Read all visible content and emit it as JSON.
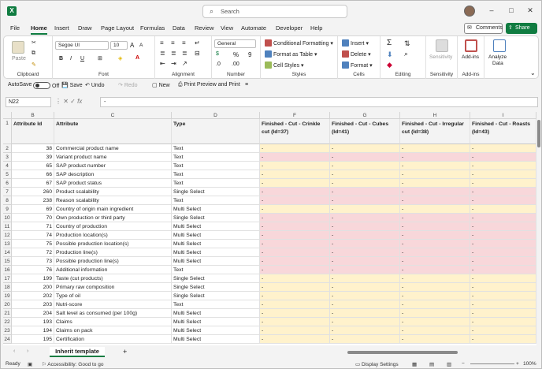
{
  "app": {
    "search_placeholder": "Search",
    "icons": {
      "logo": "excel-icon",
      "search": "search-icon"
    }
  },
  "window_controls": {
    "minimize": "–",
    "maximize": "□",
    "close": "✕"
  },
  "menu": {
    "items": [
      "File",
      "Home",
      "Insert",
      "Draw",
      "Page Layout",
      "Formulas",
      "Data",
      "Review",
      "View",
      "Automate",
      "Developer",
      "Help"
    ],
    "active": "Home"
  },
  "comments_label": "Comments",
  "share_label": "Share",
  "ribbon": {
    "clipboard": {
      "paste": "Paste",
      "label": "Clipboard"
    },
    "font": {
      "name": "Segoe UI",
      "size": "10",
      "bold": "B",
      "italic": "I",
      "underline": "U",
      "grow": "A",
      "shrink": "A",
      "label": "Font"
    },
    "alignment": {
      "label": "Alignment"
    },
    "number": {
      "format": "General",
      "percent": "%",
      "comma": "9",
      "label": "Number"
    },
    "styles": {
      "conditional": "Conditional Formatting",
      "table": "Format as Table",
      "cell_styles": "Cell Styles",
      "label": "Styles"
    },
    "cells": {
      "insert": "Insert",
      "delete": "Delete",
      "format": "Format",
      "label": "Cells"
    },
    "editing": {
      "sum": "Σ",
      "label": "Editing"
    },
    "sensitivity": {
      "button": "Sensitivity",
      "label": "Sensitivity"
    },
    "addins": {
      "button": "Add-ins",
      "label": "Add-ins"
    },
    "analyze": {
      "button1": "Analyze",
      "button2": "Data"
    }
  },
  "qat": {
    "autosave": "AutoSave",
    "autosave_state": "Off",
    "save": "Save",
    "undo": "Undo",
    "redo": "Redo",
    "new": "New",
    "print": "Print Preview and Print"
  },
  "formula_bar": {
    "name_box": "N22",
    "fx": "fx",
    "value": "-"
  },
  "columns": [
    "B",
    "C",
    "D",
    "F",
    "G",
    "H",
    "I"
  ],
  "headers": [
    "Attribute Id",
    "Attribute",
    "Type",
    "Finished - Cut - Crinkle cut (Id=37)",
    "Finished - Cut - Cubes (Id=41)",
    "Finished - Cut - Irregular cut (Id=38)",
    "Finished - Cut - Roasts (Id=43)"
  ],
  "rows": [
    {
      "n": "2",
      "id": "38",
      "attr": "Commercial product name",
      "type": "Text",
      "band": "y"
    },
    {
      "n": "3",
      "id": "39",
      "attr": "Variant product name",
      "type": "Text",
      "band": "p"
    },
    {
      "n": "4",
      "id": "65",
      "attr": "SAP product number",
      "type": "Text",
      "band": "y"
    },
    {
      "n": "5",
      "id": "66",
      "attr": "SAP description",
      "type": "Text",
      "band": "y"
    },
    {
      "n": "6",
      "id": "67",
      "attr": "SAP product status",
      "type": "Text",
      "band": "y"
    },
    {
      "n": "7",
      "id": "260",
      "attr": "Product scalability",
      "type": "Single Select",
      "band": "p"
    },
    {
      "n": "8",
      "id": "238",
      "attr": "Reason scalability",
      "type": "Text",
      "band": "p"
    },
    {
      "n": "9",
      "id": "69",
      "attr": "Country of origin main ingredient",
      "type": "Multi Select",
      "band": "y"
    },
    {
      "n": "10",
      "id": "70",
      "attr": "Own production or third party",
      "type": "Single Select",
      "band": "p"
    },
    {
      "n": "11",
      "id": "71",
      "attr": "Country of production",
      "type": "Multi Select",
      "band": "p"
    },
    {
      "n": "12",
      "id": "74",
      "attr": "Production location(s)",
      "type": "Multi Select",
      "band": "p"
    },
    {
      "n": "13",
      "id": "75",
      "attr": "Possible production location(s)",
      "type": "Multi Select",
      "band": "p"
    },
    {
      "n": "14",
      "id": "72",
      "attr": "Production line(s)",
      "type": "Multi Select",
      "band": "p"
    },
    {
      "n": "15",
      "id": "73",
      "attr": "Possible production line(s)",
      "type": "Multi Select",
      "band": "p"
    },
    {
      "n": "16",
      "id": "76",
      "attr": "Additional information",
      "type": "Text",
      "band": "p"
    },
    {
      "n": "17",
      "id": "199",
      "attr": "Taste (cut products)",
      "type": "Single Select",
      "band": "y"
    },
    {
      "n": "18",
      "id": "200",
      "attr": "Primary raw composition",
      "type": "Single Select",
      "band": "y"
    },
    {
      "n": "19",
      "id": "202",
      "attr": "Type of oil",
      "type": "Single Select",
      "band": "y"
    },
    {
      "n": "20",
      "id": "203",
      "attr": "Nutri-score",
      "type": "Text",
      "band": "y"
    },
    {
      "n": "21",
      "id": "204",
      "attr": "Salt level as consumed (per 100g)",
      "type": "Multi Select",
      "band": "y"
    },
    {
      "n": "22",
      "id": "193",
      "attr": "Claims",
      "type": "Multi Select",
      "band": "y"
    },
    {
      "n": "23",
      "id": "194",
      "attr": "Claims on pack",
      "type": "Multi Select",
      "band": "y"
    },
    {
      "n": "24",
      "id": "195",
      "attr": "Certification",
      "type": "Multi Select",
      "band": "y"
    }
  ],
  "cell_value": "-",
  "colors": {
    "yellow": "#fff2cc",
    "pink": "#f8d7da",
    "green": "#107c41"
  },
  "sheet_tab": "Inherit template",
  "status": {
    "ready": "Ready",
    "accessibility": "Accessibility: Good to go",
    "display": "Display Settings",
    "zoom": "100%"
  }
}
